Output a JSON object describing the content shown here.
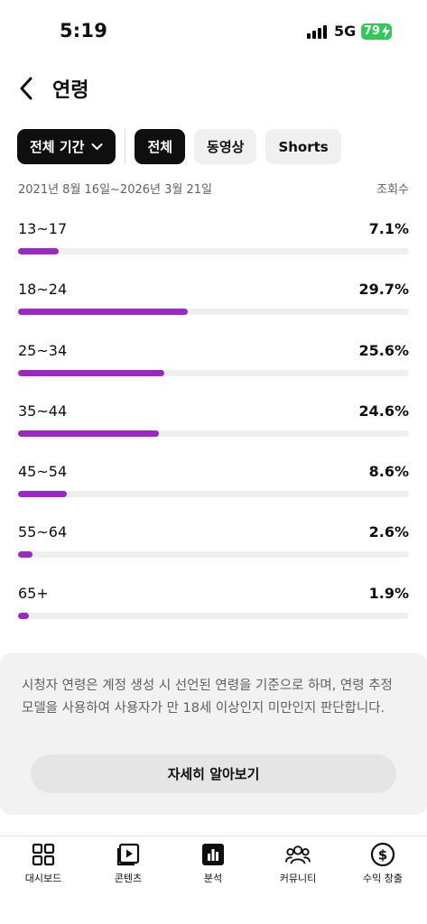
{
  "status": {
    "time": "5:19",
    "network": "5G",
    "battery": "79"
  },
  "header": {
    "title": "연령"
  },
  "filters": {
    "period_label": "전체 기간",
    "chips": [
      "전체",
      "동영상",
      "Shorts"
    ],
    "selected": "전체"
  },
  "date_range": "2021년 8월 16일~2026년 3월 21일",
  "metric_label": "조회수",
  "chart_data": {
    "type": "bar",
    "categories": [
      "13~17",
      "18~24",
      "25~34",
      "35~44",
      "45~54",
      "55~64",
      "65+"
    ],
    "values": [
      7.1,
      29.7,
      25.6,
      24.6,
      8.6,
      2.6,
      1.9
    ],
    "value_labels": [
      "7.1%",
      "29.7%",
      "25.6%",
      "24.6%",
      "8.6%",
      "2.6%",
      "1.9%"
    ],
    "ylim": [
      0,
      100
    ],
    "bar_color": "#9c27c4"
  },
  "info": {
    "text": "시청자 연령은 계정 생성 시 선언된 연령을 기준으로 하며, 연령 추정 모델을 사용하여 사용자가 만 18세 이상인지 미만인지 판단합니다.",
    "button": "자세히 알아보기"
  },
  "nav": {
    "dashboard": "대시보드",
    "content": "콘텐츠",
    "analytics": "분석",
    "community": "커뮤니티",
    "monetization": "수익 창출"
  }
}
